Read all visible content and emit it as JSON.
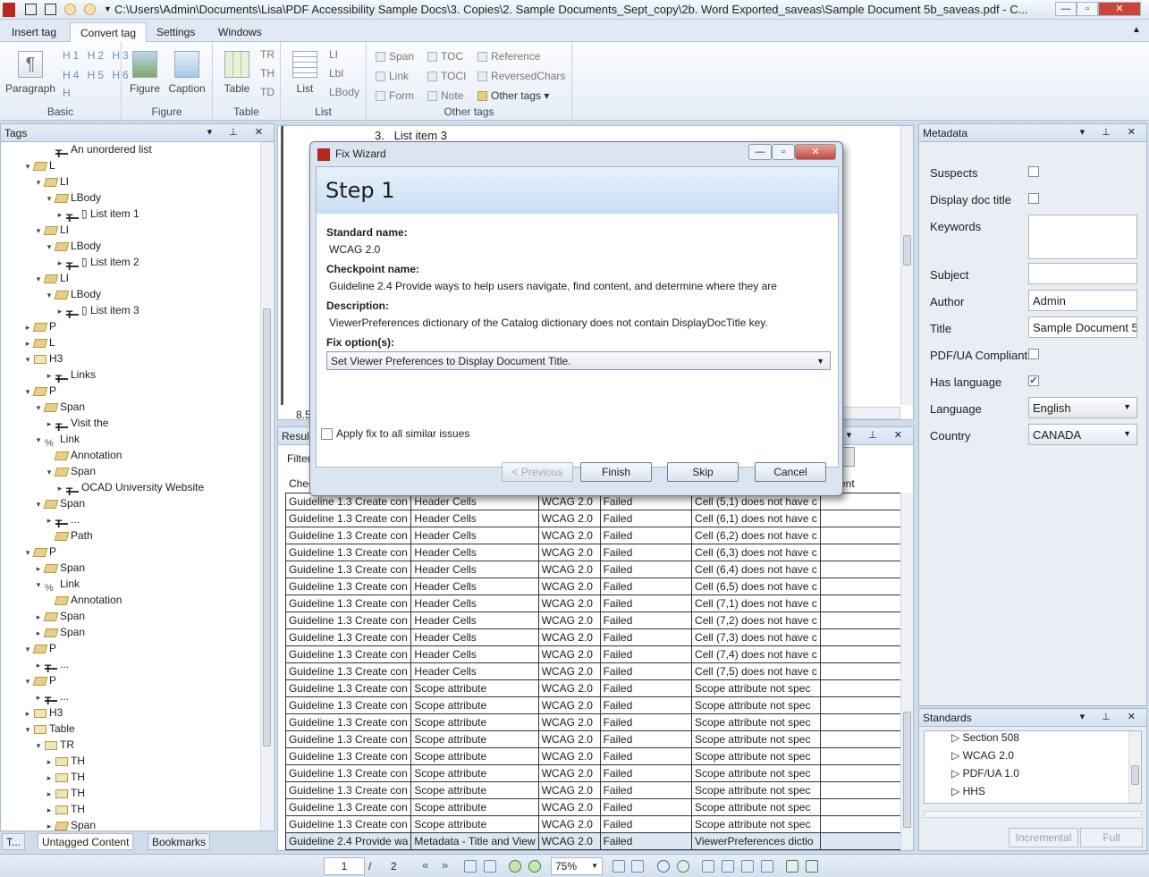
{
  "window": {
    "title": "C:\\Users\\Admin\\Documents\\Lisa\\PDF Accessibility Sample Docs\\3. Copies\\2. Sample Documents_Sept_copy\\2b. Word Exported_saveas\\Sample Document 5b_saveas.pdf - C..."
  },
  "ribbon": {
    "tabs": [
      "Insert tag",
      "Convert tag",
      "Settings",
      "Windows"
    ],
    "groups": {
      "basic": {
        "label": "Basic",
        "paragraph": "Paragraph"
      },
      "figure": {
        "label": "Figure",
        "figure": "Figure",
        "caption": "Caption"
      },
      "table": {
        "label": "Table",
        "table": "Table",
        "tr": "TR",
        "th": "TH",
        "td": "TD"
      },
      "list": {
        "label": "List",
        "list": "List",
        "li": "LI",
        "lbl": "Lbl",
        "lbody": "LBody"
      },
      "other": {
        "label": "Other tags",
        "span": "Span",
        "link": "Link",
        "form": "Form",
        "toc": "TOC",
        "toci": "TOCI",
        "note": "Note",
        "reference": "Reference",
        "reversedchars": "ReversedChars",
        "othertags": "Other tags"
      }
    }
  },
  "tags": {
    "title": "Tags",
    "rows": [
      {
        "t": "text",
        "label": "An unordered list"
      },
      {
        "t": "tag",
        "label": "L"
      },
      {
        "t": "tag",
        "label": "LI"
      },
      {
        "t": "tag",
        "label": "LBody"
      },
      {
        "t": "text",
        "label": "▯ List item 1"
      },
      {
        "t": "tag",
        "label": "LI"
      },
      {
        "t": "tag",
        "label": "LBody"
      },
      {
        "t": "text",
        "label": "▯ List item 2"
      },
      {
        "t": "tag",
        "label": "LI"
      },
      {
        "t": "tag",
        "label": "LBody"
      },
      {
        "t": "text",
        "label": "▯ List item 3"
      },
      {
        "t": "tag",
        "label": "P"
      },
      {
        "t": "tag",
        "label": "L"
      },
      {
        "t": "grid",
        "label": "H3"
      },
      {
        "t": "text",
        "label": "Links"
      },
      {
        "t": "tag",
        "label": "P"
      },
      {
        "t": "tag",
        "label": "Span"
      },
      {
        "t": "text",
        "label": "Visit the"
      },
      {
        "t": "link",
        "label": "Link"
      },
      {
        "t": "tag",
        "label": "Annotation"
      },
      {
        "t": "tag",
        "label": "Span"
      },
      {
        "t": "text",
        "label": "OCAD University Website"
      },
      {
        "t": "tag",
        "label": "Span"
      },
      {
        "t": "text",
        "label": "..."
      },
      {
        "t": "tag",
        "label": "Path"
      },
      {
        "t": "tag",
        "label": "P"
      },
      {
        "t": "tag",
        "label": "Span"
      },
      {
        "t": "link",
        "label": "Link"
      },
      {
        "t": "tag",
        "label": "Annotation"
      },
      {
        "t": "tag",
        "label": "Span"
      },
      {
        "t": "tag",
        "label": "Span"
      },
      {
        "t": "tag",
        "label": "P"
      },
      {
        "t": "text",
        "label": "..."
      },
      {
        "t": "tag",
        "label": "P"
      },
      {
        "t": "text",
        "label": "..."
      },
      {
        "t": "grid",
        "label": "H3"
      },
      {
        "t": "grid",
        "label": "Table"
      },
      {
        "t": "grid",
        "label": "TR"
      },
      {
        "t": "grid",
        "label": "TH"
      },
      {
        "t": "grid",
        "label": "TH"
      },
      {
        "t": "grid",
        "label": "TH"
      },
      {
        "t": "grid",
        "label": "TH"
      },
      {
        "t": "tag",
        "label": "Span"
      }
    ]
  },
  "document": {
    "list_item": "3.   List item 3",
    "zoom_text": "8.5"
  },
  "results": {
    "title": "Resul",
    "filter_label": "Filter",
    "col_first": "Chec",
    "col_last": "ent",
    "rows": [
      [
        "Guideline 1.3 Create con",
        "Header Cells",
        "WCAG 2.0",
        "Failed",
        "Cell (5,1) does not have c"
      ],
      [
        "Guideline 1.3 Create con",
        "Header Cells",
        "WCAG 2.0",
        "Failed",
        "Cell (6,1) does not have c"
      ],
      [
        "Guideline 1.3 Create con",
        "Header Cells",
        "WCAG 2.0",
        "Failed",
        "Cell (6,2) does not have c"
      ],
      [
        "Guideline 1.3 Create con",
        "Header Cells",
        "WCAG 2.0",
        "Failed",
        "Cell (6,3) does not have c"
      ],
      [
        "Guideline 1.3 Create con",
        "Header Cells",
        "WCAG 2.0",
        "Failed",
        "Cell (6,4) does not have c"
      ],
      [
        "Guideline 1.3 Create con",
        "Header Cells",
        "WCAG 2.0",
        "Failed",
        "Cell (6,5) does not have c"
      ],
      [
        "Guideline 1.3 Create con",
        "Header Cells",
        "WCAG 2.0",
        "Failed",
        "Cell (7,1) does not have c"
      ],
      [
        "Guideline 1.3 Create con",
        "Header Cells",
        "WCAG 2.0",
        "Failed",
        "Cell (7,2) does not have c"
      ],
      [
        "Guideline 1.3 Create con",
        "Header Cells",
        "WCAG 2.0",
        "Failed",
        "Cell (7,3) does not have c"
      ],
      [
        "Guideline 1.3 Create con",
        "Header Cells",
        "WCAG 2.0",
        "Failed",
        "Cell (7,4) does not have c"
      ],
      [
        "Guideline 1.3 Create con",
        "Header Cells",
        "WCAG 2.0",
        "Failed",
        "Cell (7,5) does not have c"
      ],
      [
        "Guideline 1.3 Create con",
        "Scope attribute",
        "WCAG 2.0",
        "Failed",
        "Scope attribute not spec"
      ],
      [
        "Guideline 1.3 Create con",
        "Scope attribute",
        "WCAG 2.0",
        "Failed",
        "Scope attribute not spec"
      ],
      [
        "Guideline 1.3 Create con",
        "Scope attribute",
        "WCAG 2.0",
        "Failed",
        "Scope attribute not spec"
      ],
      [
        "Guideline 1.3 Create con",
        "Scope attribute",
        "WCAG 2.0",
        "Failed",
        "Scope attribute not spec"
      ],
      [
        "Guideline 1.3 Create con",
        "Scope attribute",
        "WCAG 2.0",
        "Failed",
        "Scope attribute not spec"
      ],
      [
        "Guideline 1.3 Create con",
        "Scope attribute",
        "WCAG 2.0",
        "Failed",
        "Scope attribute not spec"
      ],
      [
        "Guideline 1.3 Create con",
        "Scope attribute",
        "WCAG 2.0",
        "Failed",
        "Scope attribute not spec"
      ],
      [
        "Guideline 1.3 Create con",
        "Scope attribute",
        "WCAG 2.0",
        "Failed",
        "Scope attribute not spec"
      ],
      [
        "Guideline 1.3 Create con",
        "Scope attribute",
        "WCAG 2.0",
        "Failed",
        "Scope attribute not spec"
      ],
      [
        "Guideline 2.4 Provide wa",
        "Metadata - Title and View",
        "WCAG 2.0",
        "Failed",
        "ViewerPreferences dictio"
      ]
    ]
  },
  "metadata": {
    "title": "Metadata",
    "suspects": "Suspects",
    "display_doc_title": "Display doc title",
    "keywords": "Keywords",
    "subject": "Subject",
    "author": "Author",
    "author_value": "Admin",
    "title_label": "Title",
    "title_value": "Sample Document 5",
    "pdfua": "PDF/UA Compliant",
    "has_language": "Has language",
    "has_language_check": "✔",
    "language": "Language",
    "language_value": "English",
    "country": "Country",
    "country_value": "CANADA"
  },
  "standards": {
    "title": "Standards",
    "items": [
      "Section 508",
      "WCAG 2.0",
      "PDF/UA 1.0",
      "HHS"
    ],
    "incremental": "Incremental",
    "full": "Full"
  },
  "bottom_tabs": [
    "T...",
    "Untagged Content",
    "Bookmarks"
  ],
  "statusbar": {
    "page": "1",
    "sep": "/",
    "total": "2",
    "zoom": "75%"
  },
  "dialog": {
    "title": "Fix Wizard",
    "step": "Step 1",
    "standard_label": "Standard name:",
    "standard_value": "WCAG 2.0",
    "checkpoint_label": "Checkpoint name:",
    "checkpoint_value": "Guideline 2.4 Provide ways to help users navigate, find content, and determine where they are",
    "description_label": "Description:",
    "description_value": "ViewerPreferences dictionary of the Catalog dictionary does not contain DisplayDocTitle key.",
    "fix_label": "Fix option(s):",
    "fix_value": "Set Viewer Preferences to Display Document Title.",
    "apply_all": "Apply fix to all similar issues",
    "previous": "< Previous",
    "finish": "Finish",
    "skip": "Skip",
    "cancel": "Cancel"
  }
}
